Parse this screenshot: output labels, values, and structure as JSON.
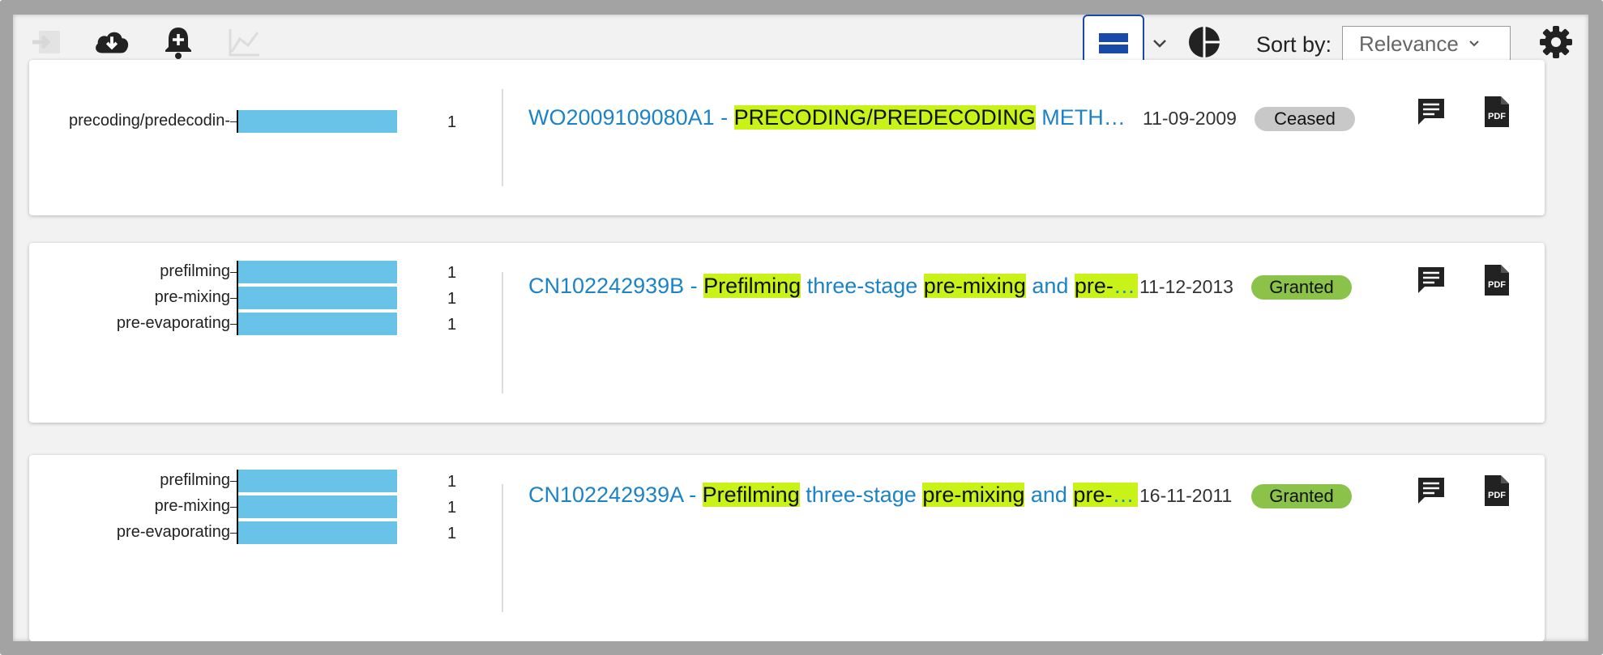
{
  "toolbar": {
    "icons": [
      "import-icon",
      "cloud-download-icon",
      "add-alert-icon",
      "chart-icon",
      "list-view-icon",
      "chevron-down-icon",
      "pie-chart-icon",
      "gear-icon"
    ],
    "sort_label": "Sort by:",
    "sort_value": "Relevance"
  },
  "colors": {
    "accent": "#1c83c6",
    "highlight": "#c8f218",
    "bar": "#69c3e8",
    "ceased": "#c8c8c8",
    "granted": "#8bc34a"
  },
  "results": [
    {
      "chart": {
        "type": "bar",
        "categories": [
          "precoding/predecodin-"
        ],
        "values": [
          1
        ]
      },
      "id": "WO2009109080A1",
      "sep": " - ",
      "title_parts": [
        {
          "text": "PRECODING/PREDECODING",
          "hl": true
        },
        {
          "text": " METHOD AND APPARATUS FOR DATA TRANSMISSION",
          "hl": false
        }
      ],
      "date": "11-09-2009",
      "status": "Ceased"
    },
    {
      "chart": {
        "type": "bar",
        "categories": [
          "prefilming",
          "pre-mixing",
          "pre-evaporating"
        ],
        "values": [
          1,
          1,
          1
        ]
      },
      "id": "CN102242939B",
      "sep": " - ",
      "title_parts": [
        {
          "text": "Prefilming",
          "hl": true
        },
        {
          "text": " three-stage ",
          "hl": false
        },
        {
          "text": "pre-mixing",
          "hl": true
        },
        {
          "text": " and ",
          "hl": false
        },
        {
          "text": "pre-evaporating",
          "hl": true
        }
      ],
      "date": "11-12-2013",
      "status": "Granted"
    },
    {
      "chart": {
        "type": "bar",
        "categories": [
          "prefilming",
          "pre-mixing",
          "pre-evaporating"
        ],
        "values": [
          1,
          1,
          1
        ]
      },
      "id": "CN102242939A",
      "sep": " - ",
      "title_parts": [
        {
          "text": "Prefilming",
          "hl": true
        },
        {
          "text": " three-stage ",
          "hl": false
        },
        {
          "text": "pre-mixing",
          "hl": true
        },
        {
          "text": " and ",
          "hl": false
        },
        {
          "text": "pre-evaporating",
          "hl": true
        }
      ],
      "date": "16-11-2011",
      "status": "Granted"
    }
  ]
}
